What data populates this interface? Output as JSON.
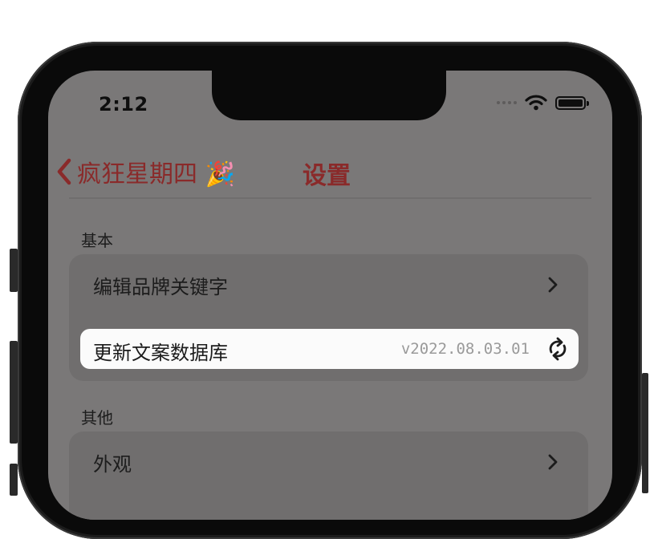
{
  "status_bar": {
    "time": "2:12"
  },
  "nav": {
    "back_label": "疯狂星期四 🎉",
    "title": "设置"
  },
  "sections": {
    "basic": {
      "header": "基本",
      "rows": [
        {
          "label": "编辑品牌关键字"
        },
        {
          "label": "更新文案数据库",
          "value": "v2022.08.03.01"
        }
      ]
    },
    "other": {
      "header": "其他",
      "rows": [
        {
          "label": "外观"
        }
      ]
    }
  },
  "colors": {
    "accent": "#8a2a2a",
    "dimmed_background": "#7a7878",
    "group_background": "#706e6e",
    "highlight_row": "#fbfbfb"
  }
}
